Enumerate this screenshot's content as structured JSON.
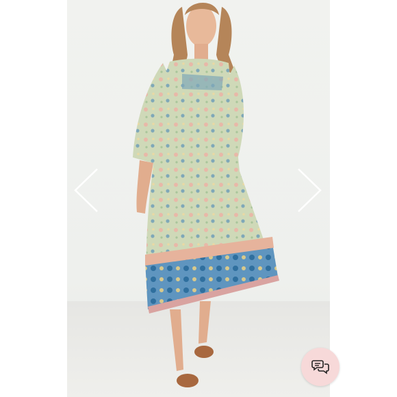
{
  "viewer": {
    "photo": {
      "alt": ""
    },
    "icons": {
      "prev": "chevron-left-icon",
      "next": "chevron-right-icon",
      "chat": "chat-bubbles-icon"
    },
    "colors": {
      "chat_button_bg": "#f7d9d9",
      "arrow": "#ffffff"
    }
  }
}
